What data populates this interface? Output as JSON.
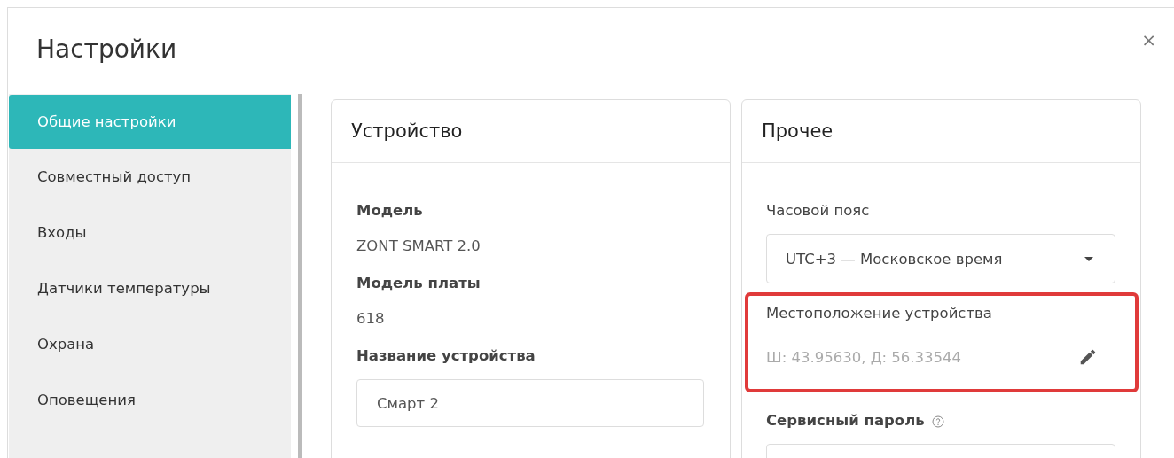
{
  "window": {
    "title": "Настройки",
    "close": "×"
  },
  "sidebar": {
    "items": [
      {
        "label": "Общие настройки",
        "selected": true
      },
      {
        "label": "Совместный доступ",
        "selected": false
      },
      {
        "label": "Входы",
        "selected": false
      },
      {
        "label": "Датчики температуры",
        "selected": false
      },
      {
        "label": "Охрана",
        "selected": false
      },
      {
        "label": "Оповещения",
        "selected": false
      }
    ]
  },
  "device_card": {
    "title": "Устройство",
    "model_label": "Модель",
    "model": "ZONT SMART 2.0",
    "board_label": "Модель платы",
    "board": "618",
    "name_label": "Название устройства",
    "name_value": "Смарт 2"
  },
  "other_card": {
    "title": "Прочее",
    "timezone_label": "Часовой пояс",
    "timezone": "UTC+3 — Московское время",
    "location_label": "Местоположение устройства",
    "location": "Ш: 43.95630, Д: 56.33544",
    "location_highlighted": true,
    "password_label": "Сервисный пароль"
  }
}
